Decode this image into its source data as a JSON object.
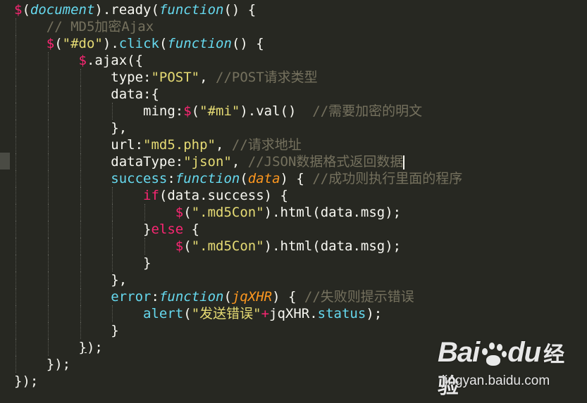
{
  "editor": {
    "theme_colors": {
      "background": "#272822",
      "default_text": "#f8f8f2",
      "keyword": "#f92672",
      "function": "#66d9ef",
      "string": "#e6db74",
      "comment": "#75715e",
      "argument": "#fd971f"
    },
    "lines": [
      [
        [
          "kw",
          "$"
        ],
        [
          "",
          "("
        ],
        [
          "fn it",
          "document"
        ],
        [
          "",
          ").ready("
        ],
        [
          "fn it",
          "function"
        ],
        [
          "",
          "() {"
        ]
      ],
      [
        [
          "",
          "    "
        ],
        [
          "cm",
          "// MD5加密Ajax"
        ]
      ],
      [
        [
          "",
          "    "
        ],
        [
          "kw",
          "$"
        ],
        [
          "",
          "("
        ],
        [
          "str",
          "\"#do\""
        ],
        [
          "",
          ")."
        ],
        [
          "fn",
          "click"
        ],
        [
          "",
          "("
        ],
        [
          "fn it",
          "function"
        ],
        [
          "",
          "() {"
        ]
      ],
      [
        [
          "",
          "        "
        ],
        [
          "kw",
          "$"
        ],
        [
          "",
          ".ajax({"
        ]
      ],
      [
        [
          "",
          "            type:"
        ],
        [
          "str",
          "\"POST\""
        ],
        [
          "",
          ", "
        ],
        [
          "cm",
          "//POST请求类型"
        ]
      ],
      [
        [
          "",
          "            data:{"
        ]
      ],
      [
        [
          "",
          "                ming:"
        ],
        [
          "kw",
          "$"
        ],
        [
          "",
          "("
        ],
        [
          "str",
          "\"#mi\""
        ],
        [
          "",
          ").val()  "
        ],
        [
          "cm",
          "//需要加密的明文"
        ]
      ],
      [
        [
          "",
          "            },"
        ]
      ],
      [
        [
          "",
          "            url:"
        ],
        [
          "str",
          "\"md5.php\""
        ],
        [
          "",
          ", "
        ],
        [
          "cm",
          "//请求地址"
        ]
      ],
      [
        [
          "",
          "            dataType:"
        ],
        [
          "str",
          "\"json\""
        ],
        [
          "",
          ", "
        ],
        [
          "cm",
          "//JSON数据格式返回数据"
        ]
      ],
      [
        [
          "",
          "            "
        ],
        [
          "fn",
          "success"
        ],
        [
          "",
          ":"
        ],
        [
          "fn it",
          "function"
        ],
        [
          "",
          "("
        ],
        [
          "arg",
          "data"
        ],
        [
          "",
          ") { "
        ],
        [
          "cm",
          "//成功则执行里面的程序"
        ]
      ],
      [
        [
          "",
          "                "
        ],
        [
          "kw",
          "if"
        ],
        [
          "",
          "(data.success) {"
        ]
      ],
      [
        [
          "",
          "                    "
        ],
        [
          "kw",
          "$"
        ],
        [
          "",
          "("
        ],
        [
          "str",
          "\".md5Con\""
        ],
        [
          "",
          ").html(data.msg);"
        ]
      ],
      [
        [
          "",
          "                }"
        ],
        [
          "kw",
          "else"
        ],
        [
          "",
          " {"
        ]
      ],
      [
        [
          "",
          "                    "
        ],
        [
          "kw",
          "$"
        ],
        [
          "",
          "("
        ],
        [
          "str",
          "\".md5Con\""
        ],
        [
          "",
          ").html(data.msg);"
        ]
      ],
      [
        [
          "",
          "                }"
        ]
      ],
      [
        [
          "",
          "            },"
        ]
      ],
      [
        [
          "",
          "            "
        ],
        [
          "fn",
          "error"
        ],
        [
          "",
          ":"
        ],
        [
          "fn it",
          "function"
        ],
        [
          "",
          "("
        ],
        [
          "arg",
          "jqXHR"
        ],
        [
          "",
          ") { "
        ],
        [
          "cm",
          "//失败则提示错误"
        ]
      ],
      [
        [
          "",
          "                "
        ],
        [
          "fn",
          "alert"
        ],
        [
          "",
          "("
        ],
        [
          "str",
          "\"发送错误\""
        ],
        [
          "kw",
          "+"
        ],
        [
          "",
          "jqXHR."
        ],
        [
          "fn",
          "status"
        ],
        [
          "",
          ");"
        ]
      ],
      [
        [
          "",
          "            }"
        ]
      ],
      [
        [
          "",
          "        "
        ],
        [
          "bracket-match",
          "}"
        ],
        [
          "",
          ");"
        ]
      ],
      [
        [
          "",
          "    });"
        ]
      ],
      [
        [
          "",
          "});"
        ]
      ]
    ],
    "cursor_line": 9
  },
  "watermark": {
    "logo_left": "Bai",
    "logo_right": "du",
    "logo_suffix": "经验",
    "url": "jingyan.baidu.com"
  }
}
